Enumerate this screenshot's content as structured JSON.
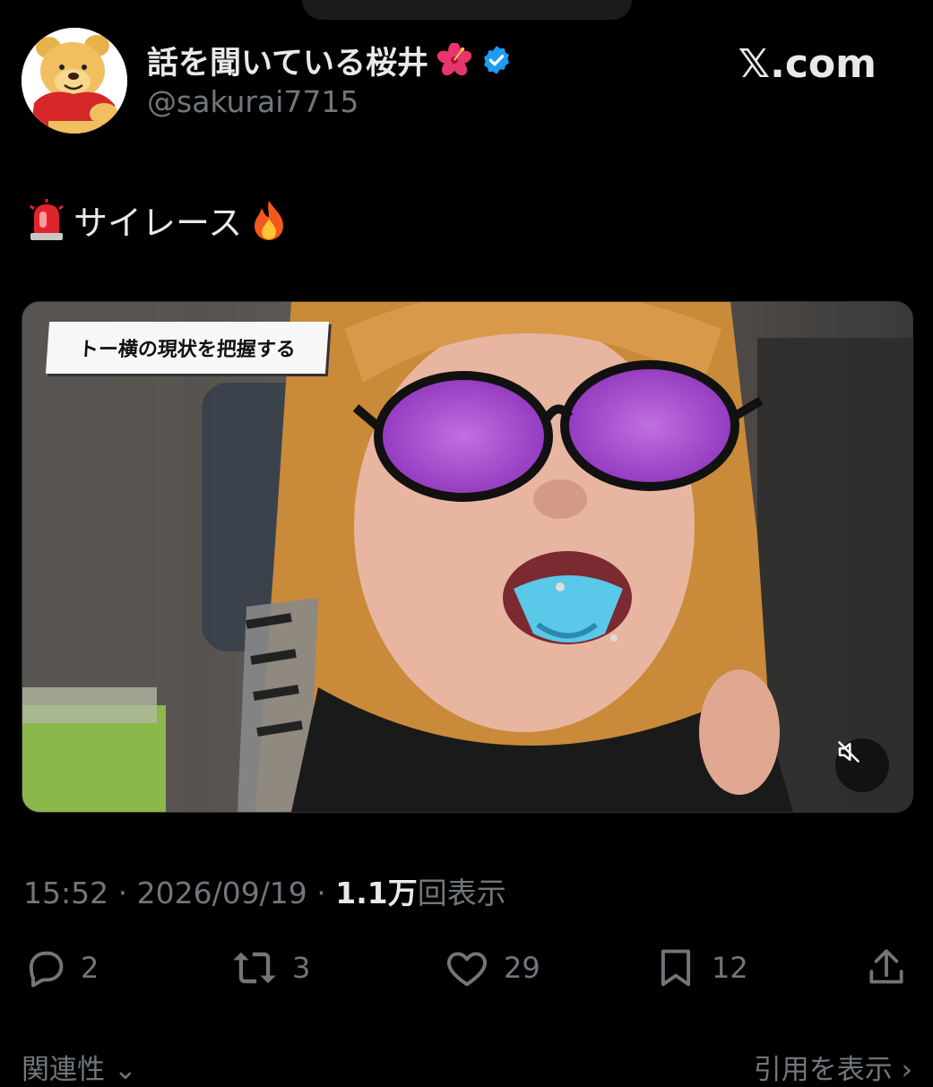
{
  "author": {
    "display_name": "話を聞いている桜井",
    "handle": "@sakurai7715",
    "verified": true
  },
  "brand": {
    "label": "𝕏.com"
  },
  "tweet": {
    "text": "サイレース",
    "leading_emoji": "siren-emoji",
    "trailing_emoji": "fire-emoji"
  },
  "media": {
    "caption": "トー横の現状を把握する",
    "muted": true
  },
  "meta": {
    "time": "15:52",
    "sep": " · ",
    "date": "2026/09/19",
    "views_count": "1.1",
    "views_unit": "万",
    "views_label": "回表示"
  },
  "actions": {
    "replies": "2",
    "reposts": "3",
    "likes": "29",
    "bookmarks": "12"
  },
  "footer": {
    "related_label": "関連性",
    "quotes_label": "引用を表示"
  },
  "colors": {
    "background": "#000000",
    "text_primary": "#e7e9ea",
    "text_secondary": "#71767b",
    "verified": "#1d9bf0"
  }
}
